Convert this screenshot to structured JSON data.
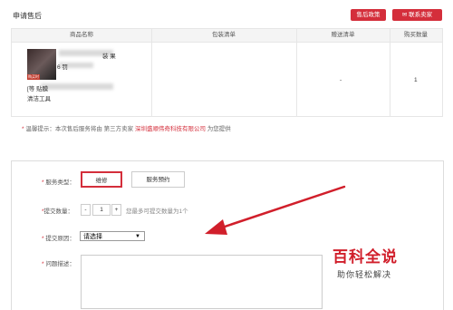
{
  "header": {
    "title": "申请售后",
    "policy_button": "售后政策",
    "contact_button": "联系卖家"
  },
  "table": {
    "columns": [
      "商品名称",
      "包装清单",
      "赠送清单",
      "购买数量"
    ],
    "row": {
      "product_name_line1": "装 果",
      "product_name_line2": "6      罚",
      "product_name_line3": "[等    贴膜",
      "product_name_line4": "清洁工具",
      "thumb_tag": "购买时",
      "gift": "-",
      "quantity": "1"
    }
  },
  "tip": {
    "star": "*",
    "prefix": "温馨提示：",
    "text": "本次售后服务将由 第三方卖家 ",
    "seller": "深圳盛顺伟奇科技有限公司",
    "suffix": " 为您提供"
  },
  "form": {
    "service_type_label": "服务类型：",
    "repair": "维修",
    "reservation": "服务预约",
    "quantity_label": "提交数量：",
    "minus": "-",
    "quantity_value": "1",
    "plus": "+",
    "quantity_hint": "您最多可提交数量为1个",
    "reason_label": "提交原因：",
    "reason_value": "请选择",
    "description_label": "问题描述："
  },
  "watermark": {
    "title": "百科全说",
    "subtitle": "助你轻松解决"
  },
  "colors": {
    "accent": "#d42e3b",
    "arrow": "#d11f2b"
  }
}
